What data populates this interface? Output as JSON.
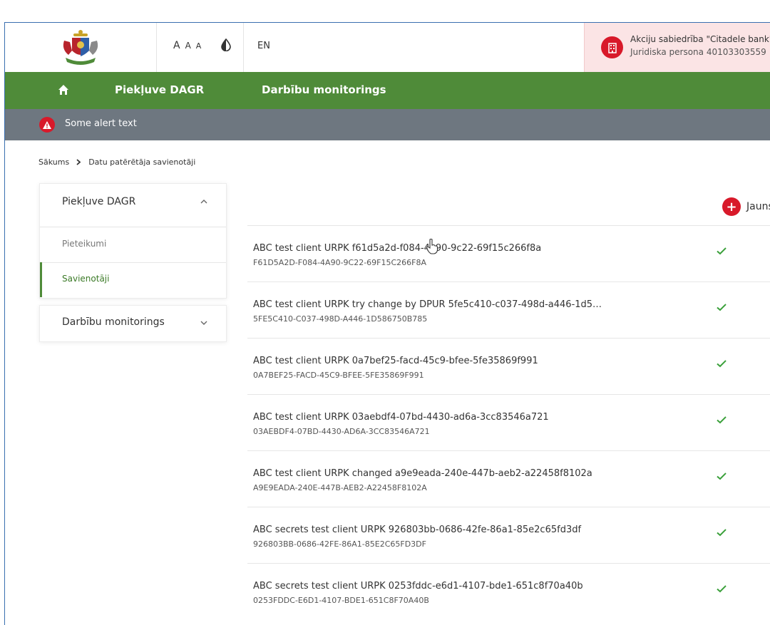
{
  "header": {
    "font_sizes": [
      "A",
      "A",
      "A"
    ],
    "lang": "EN",
    "account": {
      "name": "Akciju sabiedrība \"Citadele bank\"",
      "id": "Juridiska persona 40103303559"
    }
  },
  "nav": {
    "items": [
      "Piekļuve DAGR",
      "Darbību monitorings"
    ]
  },
  "alert": {
    "text": "Some alert text"
  },
  "breadcrumb": {
    "home": "Sākums",
    "current": "Datu patērētāja savienotāji"
  },
  "sidebar": {
    "group1": {
      "label": "Piekļuve DAGR",
      "items": [
        "Pieteikumi",
        "Savienotāji"
      ]
    },
    "group2": {
      "label": "Darbību monitorings"
    }
  },
  "main": {
    "new_button": "Jauns",
    "rows": [
      {
        "title": "ABC test client URPK f61d5a2d-f084-4a90-9c22-69f15c266f8a",
        "sub": "F61D5A2D-F084-4A90-9C22-69F15C266F8A"
      },
      {
        "title": "ABC test client URPK try change by DPUR 5fe5c410-c037-498d-a446-1d5…",
        "sub": "5FE5C410-C037-498D-A446-1D586750B785"
      },
      {
        "title": "ABC test client URPK 0a7bef25-facd-45c9-bfee-5fe35869f991",
        "sub": "0A7BEF25-FACD-45C9-BFEE-5FE35869F991"
      },
      {
        "title": "ABC test client URPK 03aebdf4-07bd-4430-ad6a-3cc83546a721",
        "sub": "03AEBDF4-07BD-4430-AD6A-3CC83546A721"
      },
      {
        "title": "ABC test client URPK changed a9e9eada-240e-447b-aeb2-a22458f8102a",
        "sub": "A9E9EADA-240E-447B-AEB2-A22458F8102A"
      },
      {
        "title": "ABC secrets test client URPK 926803bb-0686-42fe-86a1-85e2c65fd3df",
        "sub": "926803BB-0686-42FE-86A1-85E2C65FD3DF"
      },
      {
        "title": "ABC secrets test client URPK 0253fddc-e6d1-4107-bde1-651c8f70a40b",
        "sub": "0253FDDC-E6D1-4107-BDE1-651C8F70A40B"
      }
    ]
  },
  "colors": {
    "brand_green": "#4f8b39",
    "alert_gray": "#6e7780",
    "accent_red": "#d8192a",
    "check_green": "#3aa03a"
  }
}
